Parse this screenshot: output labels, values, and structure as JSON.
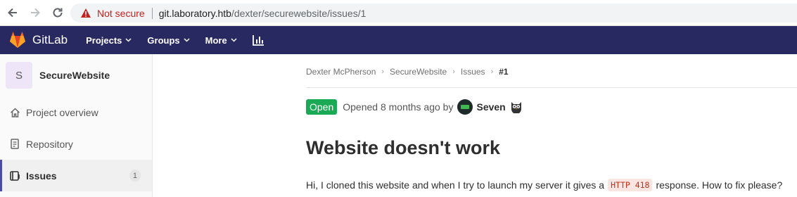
{
  "browser": {
    "security_label": "Not secure",
    "url_host": "git.laboratory.htb",
    "url_path": "/dexter/securewebsite/issues/1"
  },
  "header": {
    "logo_text": "GitLab",
    "nav": [
      {
        "label": "Projects"
      },
      {
        "label": "Groups"
      },
      {
        "label": "More"
      }
    ],
    "brand_color": "#292961"
  },
  "sidebar": {
    "project_initial": "S",
    "project_name": "SecureWebsite",
    "items": [
      {
        "label": "Project overview",
        "icon": "home-icon"
      },
      {
        "label": "Repository",
        "icon": "document-icon"
      },
      {
        "label": "Issues",
        "icon": "issues-icon",
        "count": "1",
        "active": true
      }
    ]
  },
  "breadcrumb": [
    "Dexter McPherson",
    "SecureWebsite",
    "Issues",
    "#1"
  ],
  "issue": {
    "status": "Open",
    "status_color": "#1aaa55",
    "opened_text": "Opened 8 months ago by",
    "author": "Seven",
    "title": "Website doesn't work",
    "desc_before": "Hi, I cloned this website and when I try to launch my server it gives a",
    "desc_code": "HTTP 418",
    "desc_after": "response. How to fix please?"
  }
}
